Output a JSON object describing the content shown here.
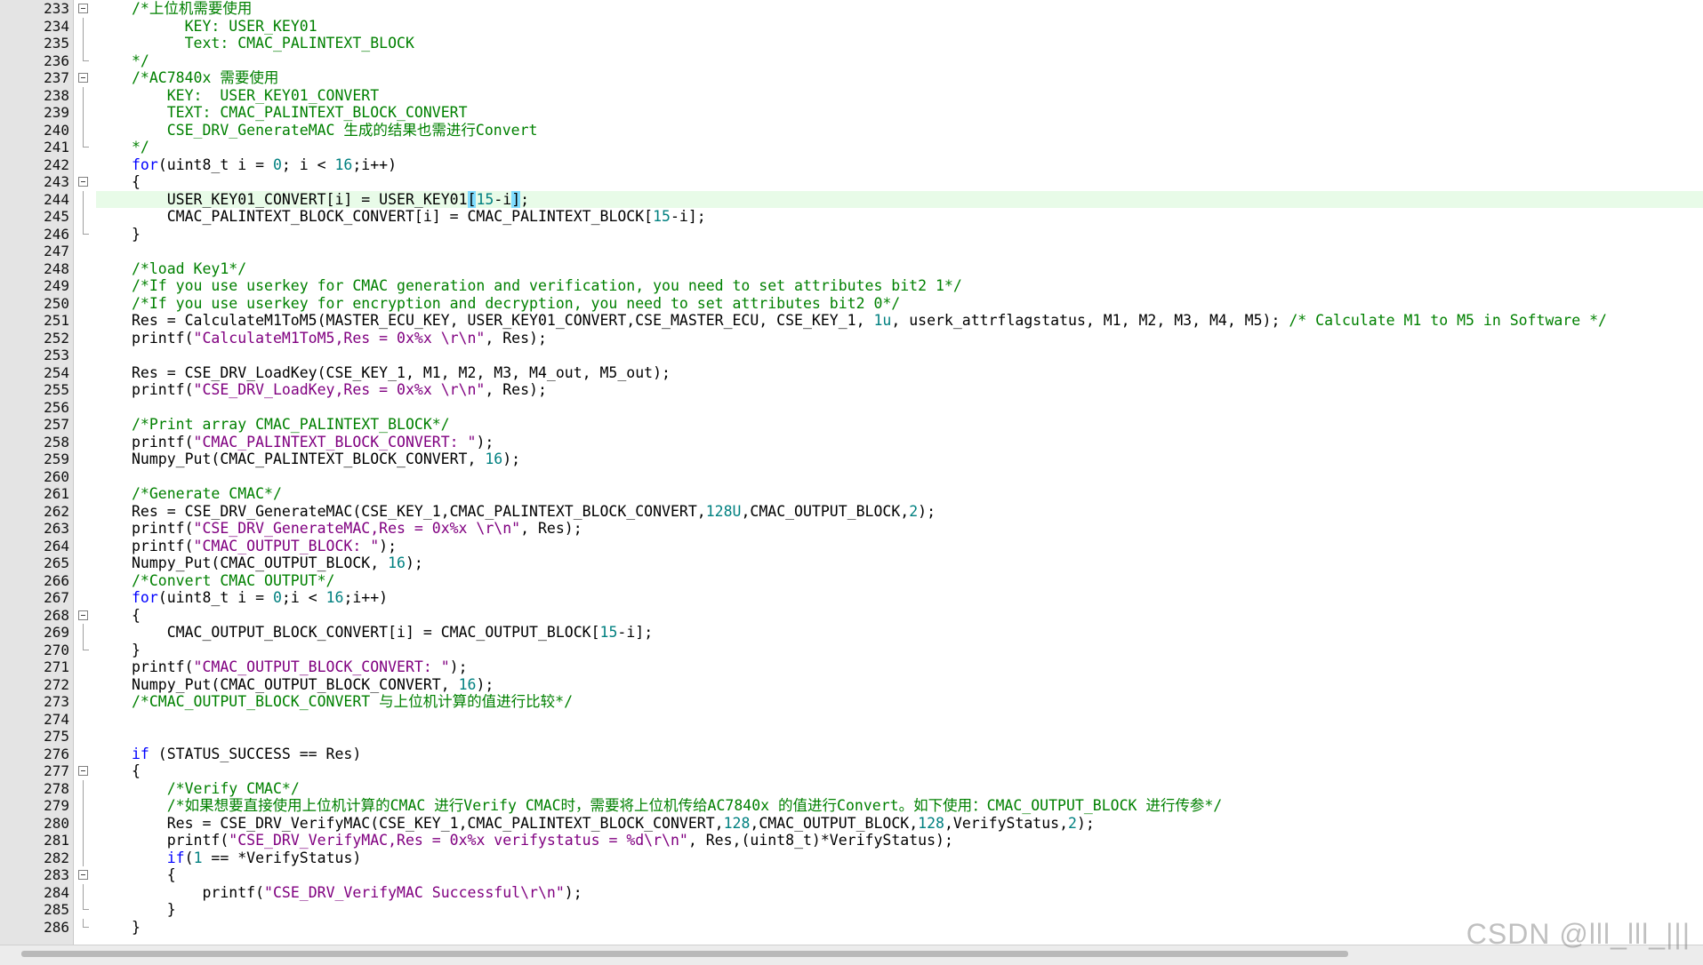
{
  "editor": {
    "lines": [
      {
        "n": "233",
        "fold": "box",
        "indent": 0,
        "tokens": [
          [
            "c",
            "/*上位机需要使用"
          ]
        ]
      },
      {
        "n": "234",
        "fold": "line",
        "indent": 1,
        "tokens": [
          [
            "c",
            "  KEY: USER_KEY01"
          ]
        ]
      },
      {
        "n": "235",
        "fold": "line",
        "indent": 1,
        "tokens": [
          [
            "c",
            "  Text: CMAC_PALINTEXT_BLOCK"
          ]
        ]
      },
      {
        "n": "236",
        "fold": "end",
        "indent": 0,
        "tokens": [
          [
            "c",
            "*/"
          ]
        ]
      },
      {
        "n": "237",
        "fold": "box",
        "indent": 0,
        "tokens": [
          [
            "c",
            "/*AC7840x 需要使用"
          ]
        ]
      },
      {
        "n": "238",
        "fold": "line",
        "indent": 1,
        "tokens": [
          [
            "c",
            "KEY:  USER_KEY01_CONVERT"
          ]
        ]
      },
      {
        "n": "239",
        "fold": "line",
        "indent": 1,
        "tokens": [
          [
            "c",
            "TEXT: CMAC_PALINTEXT_BLOCK_CONVERT"
          ]
        ]
      },
      {
        "n": "240",
        "fold": "line",
        "indent": 1,
        "tokens": [
          [
            "c",
            "CSE_DRV_GenerateMAC 生成的结果也需进行Convert"
          ]
        ]
      },
      {
        "n": "241",
        "fold": "end",
        "indent": 0,
        "tokens": [
          [
            "c",
            "*/"
          ]
        ]
      },
      {
        "n": "242",
        "fold": "",
        "indent": 0,
        "tokens": [
          [
            "k",
            "for"
          ],
          [
            "p",
            "(uint8_t i = "
          ],
          [
            "n",
            "0"
          ],
          [
            "p",
            "; i < "
          ],
          [
            "n",
            "16"
          ],
          [
            "p",
            ";i++)"
          ]
        ]
      },
      {
        "n": "243",
        "fold": "box",
        "indent": 0,
        "tokens": [
          [
            "p",
            "{"
          ]
        ]
      },
      {
        "n": "244",
        "fold": "line",
        "indent": 1,
        "current": true,
        "tokens": [
          [
            "p",
            "USER_KEY01_CONVERT[i] = USER_KEY01"
          ],
          [
            "h",
            "["
          ],
          [
            "n",
            "15"
          ],
          [
            "p",
            "-i"
          ],
          [
            "h",
            "]"
          ],
          [
            "p",
            ";"
          ]
        ]
      },
      {
        "n": "245",
        "fold": "line",
        "indent": 1,
        "tokens": [
          [
            "p",
            "CMAC_PALINTEXT_BLOCK_CONVERT[i] = CMAC_PALINTEXT_BLOCK["
          ],
          [
            "n",
            "15"
          ],
          [
            "p",
            "-i];"
          ]
        ]
      },
      {
        "n": "246",
        "fold": "end",
        "indent": 0,
        "tokens": [
          [
            "p",
            "}"
          ]
        ]
      },
      {
        "n": "247",
        "fold": "",
        "indent": 0,
        "tokens": []
      },
      {
        "n": "248",
        "fold": "",
        "indent": 0,
        "tokens": [
          [
            "c",
            "/*load Key1*/"
          ]
        ]
      },
      {
        "n": "249",
        "fold": "",
        "indent": 0,
        "tokens": [
          [
            "c",
            "/*If you use userkey for CMAC generation and verification, you need to set attributes bit2 1*/"
          ]
        ]
      },
      {
        "n": "250",
        "fold": "",
        "indent": 0,
        "tokens": [
          [
            "c",
            "/*If you use userkey for encryption and decryption, you need to set attributes bit2 0*/"
          ]
        ]
      },
      {
        "n": "251",
        "fold": "",
        "indent": 0,
        "tokens": [
          [
            "p",
            "Res = CalculateM1ToM5(MASTER_ECU_KEY, USER_KEY01_CONVERT,CSE_MASTER_ECU, CSE_KEY_1, "
          ],
          [
            "n",
            "1u"
          ],
          [
            "p",
            ", userk_attrflagstatus, M1, M2, M3, M4, M5); "
          ],
          [
            "c",
            "/* Calculate M1 to M5 in Software */"
          ]
        ]
      },
      {
        "n": "252",
        "fold": "",
        "indent": 0,
        "tokens": [
          [
            "p",
            "printf("
          ],
          [
            "s",
            "\"CalculateM1ToM5,Res = 0x%x \\r\\n\""
          ],
          [
            "p",
            ", Res);"
          ]
        ]
      },
      {
        "n": "253",
        "fold": "",
        "indent": 0,
        "tokens": []
      },
      {
        "n": "254",
        "fold": "",
        "indent": 0,
        "tokens": [
          [
            "p",
            "Res = CSE_DRV_LoadKey(CSE_KEY_1, M1, M2, M3, M4_out, M5_out);"
          ]
        ]
      },
      {
        "n": "255",
        "fold": "",
        "indent": 0,
        "tokens": [
          [
            "p",
            "printf("
          ],
          [
            "s",
            "\"CSE_DRV_LoadKey,Res = 0x%x \\r\\n\""
          ],
          [
            "p",
            ", Res);"
          ]
        ]
      },
      {
        "n": "256",
        "fold": "",
        "indent": 0,
        "tokens": []
      },
      {
        "n": "257",
        "fold": "",
        "indent": 0,
        "tokens": [
          [
            "c",
            "/*Print array CMAC_PALINTEXT_BLOCK*/"
          ]
        ]
      },
      {
        "n": "258",
        "fold": "",
        "indent": 0,
        "tokens": [
          [
            "p",
            "printf("
          ],
          [
            "s",
            "\"CMAC_PALINTEXT_BLOCK_CONVERT: \""
          ],
          [
            "p",
            ");"
          ]
        ]
      },
      {
        "n": "259",
        "fold": "",
        "indent": 0,
        "tokens": [
          [
            "p",
            "Numpy_Put(CMAC_PALINTEXT_BLOCK_CONVERT, "
          ],
          [
            "n",
            "16"
          ],
          [
            "p",
            ");"
          ]
        ]
      },
      {
        "n": "260",
        "fold": "",
        "indent": 0,
        "tokens": []
      },
      {
        "n": "261",
        "fold": "",
        "indent": 0,
        "tokens": [
          [
            "c",
            "/*Generate CMAC*/"
          ]
        ]
      },
      {
        "n": "262",
        "fold": "",
        "indent": 0,
        "tokens": [
          [
            "p",
            "Res = CSE_DRV_GenerateMAC(CSE_KEY_1,CMAC_PALINTEXT_BLOCK_CONVERT,"
          ],
          [
            "n",
            "128U"
          ],
          [
            "p",
            ",CMAC_OUTPUT_BLOCK,"
          ],
          [
            "n",
            "2"
          ],
          [
            "p",
            ");"
          ]
        ]
      },
      {
        "n": "263",
        "fold": "",
        "indent": 0,
        "tokens": [
          [
            "p",
            "printf("
          ],
          [
            "s",
            "\"CSE_DRV_GenerateMAC,Res = 0x%x \\r\\n\""
          ],
          [
            "p",
            ", Res);"
          ]
        ]
      },
      {
        "n": "264",
        "fold": "",
        "indent": 0,
        "tokens": [
          [
            "p",
            "printf("
          ],
          [
            "s",
            "\"CMAC_OUTPUT_BLOCK: \""
          ],
          [
            "p",
            ");"
          ]
        ]
      },
      {
        "n": "265",
        "fold": "",
        "indent": 0,
        "tokens": [
          [
            "p",
            "Numpy_Put(CMAC_OUTPUT_BLOCK, "
          ],
          [
            "n",
            "16"
          ],
          [
            "p",
            ");"
          ]
        ]
      },
      {
        "n": "266",
        "fold": "",
        "indent": 0,
        "tokens": [
          [
            "c",
            "/*Convert CMAC OUTPUT*/"
          ]
        ]
      },
      {
        "n": "267",
        "fold": "",
        "indent": 0,
        "tokens": [
          [
            "k",
            "for"
          ],
          [
            "p",
            "(uint8_t i = "
          ],
          [
            "n",
            "0"
          ],
          [
            "p",
            ";i < "
          ],
          [
            "n",
            "16"
          ],
          [
            "p",
            ";i++)"
          ]
        ]
      },
      {
        "n": "268",
        "fold": "box",
        "indent": 0,
        "tokens": [
          [
            "p",
            "{"
          ]
        ]
      },
      {
        "n": "269",
        "fold": "line",
        "indent": 1,
        "tokens": [
          [
            "p",
            "CMAC_OUTPUT_BLOCK_CONVERT[i] = CMAC_OUTPUT_BLOCK["
          ],
          [
            "n",
            "15"
          ],
          [
            "p",
            "-i];"
          ]
        ]
      },
      {
        "n": "270",
        "fold": "end",
        "indent": 0,
        "tokens": [
          [
            "p",
            "}"
          ]
        ]
      },
      {
        "n": "271",
        "fold": "",
        "indent": 0,
        "tokens": [
          [
            "p",
            "printf("
          ],
          [
            "s",
            "\"CMAC_OUTPUT_BLOCK_CONVERT: \""
          ],
          [
            "p",
            ");"
          ]
        ]
      },
      {
        "n": "272",
        "fold": "",
        "indent": 0,
        "tokens": [
          [
            "p",
            "Numpy_Put(CMAC_OUTPUT_BLOCK_CONVERT, "
          ],
          [
            "n",
            "16"
          ],
          [
            "p",
            ");"
          ]
        ]
      },
      {
        "n": "273",
        "fold": "",
        "indent": 0,
        "tokens": [
          [
            "c",
            "/*CMAC_OUTPUT_BLOCK_CONVERT 与上位机计算的值进行比较*/"
          ]
        ]
      },
      {
        "n": "274",
        "fold": "",
        "indent": 0,
        "tokens": []
      },
      {
        "n": "275",
        "fold": "",
        "indent": 0,
        "tokens": []
      },
      {
        "n": "276",
        "fold": "",
        "indent": 0,
        "tokens": [
          [
            "k",
            "if"
          ],
          [
            "p",
            " (STATUS_SUCCESS == Res)"
          ]
        ]
      },
      {
        "n": "277",
        "fold": "box",
        "indent": 0,
        "tokens": [
          [
            "p",
            "{"
          ]
        ]
      },
      {
        "n": "278",
        "fold": "line",
        "indent": 1,
        "tokens": [
          [
            "c",
            "/*Verify CMAC*/"
          ]
        ]
      },
      {
        "n": "279",
        "fold": "line",
        "indent": 1,
        "tokens": [
          [
            "c",
            "/*如果想要直接使用上位机计算的CMAC 进行Verify CMAC时，需要将上位机传给AC7840x 的值进行Convert。如下使用：CMAC_OUTPUT_BLOCK 进行传参*/"
          ]
        ]
      },
      {
        "n": "280",
        "fold": "line",
        "indent": 1,
        "tokens": [
          [
            "p",
            "Res = CSE_DRV_VerifyMAC(CSE_KEY_1,CMAC_PALINTEXT_BLOCK_CONVERT,"
          ],
          [
            "n",
            "128"
          ],
          [
            "p",
            ",CMAC_OUTPUT_BLOCK,"
          ],
          [
            "n",
            "128"
          ],
          [
            "p",
            ",VerifyStatus,"
          ],
          [
            "n",
            "2"
          ],
          [
            "p",
            ");"
          ]
        ]
      },
      {
        "n": "281",
        "fold": "line",
        "indent": 1,
        "tokens": [
          [
            "p",
            "printf("
          ],
          [
            "s",
            "\"CSE_DRV_VerifyMAC,Res = 0x%x verifystatus = %d\\r\\n\""
          ],
          [
            "p",
            ", Res,(uint8_t)*VerifyStatus);"
          ]
        ]
      },
      {
        "n": "282",
        "fold": "line",
        "indent": 1,
        "tokens": [
          [
            "k",
            "if"
          ],
          [
            "p",
            "("
          ],
          [
            "n",
            "1"
          ],
          [
            "p",
            " == *VerifyStatus)"
          ]
        ]
      },
      {
        "n": "283",
        "fold": "box",
        "indent": 1,
        "tokens": [
          [
            "p",
            "{"
          ]
        ]
      },
      {
        "n": "284",
        "fold": "line",
        "indent": 2,
        "tokens": [
          [
            "p",
            "printf("
          ],
          [
            "s",
            "\"CSE_DRV_VerifyMAC Successful\\r\\n\""
          ],
          [
            "p",
            ");"
          ]
        ]
      },
      {
        "n": "285",
        "fold": "end",
        "indent": 1,
        "tokens": [
          [
            "p",
            "}"
          ]
        ]
      },
      {
        "n": "286",
        "fold": "end",
        "indent": 0,
        "tokens": [
          [
            "p",
            "}"
          ]
        ]
      }
    ]
  },
  "watermark": "CSDN @lll_lll_|||"
}
